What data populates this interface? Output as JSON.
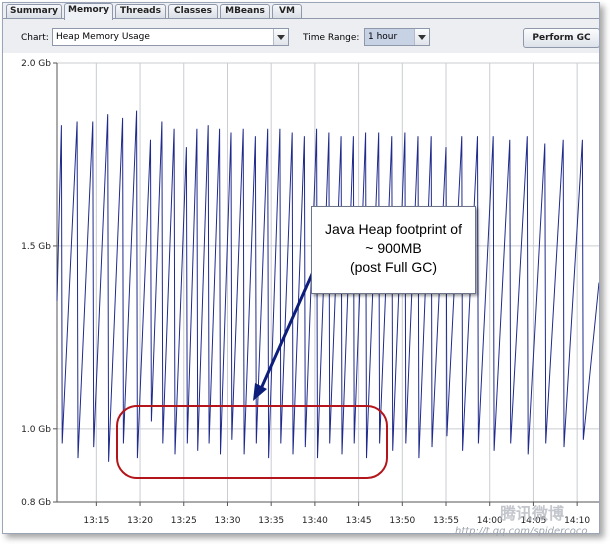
{
  "tabs": [
    {
      "label": "Summary",
      "active": false
    },
    {
      "label": "Memory",
      "active": true
    },
    {
      "label": "Threads",
      "active": false
    },
    {
      "label": "Classes",
      "active": false
    },
    {
      "label": "MBeans",
      "active": false
    },
    {
      "label": "VM",
      "active": false
    }
  ],
  "controls": {
    "chart_label": "Chart:",
    "chart_value": "Heap Memory Usage",
    "time_range_label": "Time Range:",
    "time_range_value": "1 hour",
    "perform_gc_label": "Perform GC"
  },
  "annotation": {
    "lines": [
      "Java Heap footprint of",
      "~ 900MB",
      "(post Full GC)"
    ],
    "arrow_color": "#0d1d7a",
    "ellipse_color": "#b3151a"
  },
  "watermark": {
    "logo_text": "腾讯微博",
    "url_text": "http://t.qq.com/spidercoco"
  },
  "chart_data": {
    "type": "line",
    "y_ticks": [
      "2.0 Gb",
      "1.5 Gb",
      "1.0 Gb",
      "0.8 Gb"
    ],
    "y_tick_values": [
      2.0,
      1.5,
      1.0,
      0.8
    ],
    "ylim": [
      0.8,
      2.0
    ],
    "x_ticks": [
      "13:15",
      "13:20",
      "13:25",
      "13:30",
      "13:35",
      "13:40",
      "13:45",
      "13:50",
      "13:55",
      "14:00",
      "14:05",
      "14:10"
    ],
    "x_tick_minutes": [
      15,
      20,
      25,
      30,
      35,
      40,
      45,
      50,
      55,
      60,
      65,
      70
    ],
    "xlim_minutes": [
      10.5,
      72.5
    ],
    "series_color": "#1f2a8c",
    "grid": true,
    "series": [
      {
        "points": [
          [
            10.5,
            1.35
          ],
          [
            11.0,
            1.83
          ],
          [
            11.1,
            0.96
          ],
          [
            12.8,
            1.84
          ],
          [
            12.9,
            0.92
          ],
          [
            14.6,
            1.84
          ],
          [
            14.7,
            0.95
          ],
          [
            16.3,
            1.86
          ],
          [
            16.4,
            0.91
          ],
          [
            18.0,
            1.85
          ],
          [
            18.1,
            0.96
          ],
          [
            19.6,
            1.87
          ],
          [
            19.7,
            0.92
          ],
          [
            21.2,
            1.79
          ],
          [
            21.3,
            1.02
          ],
          [
            22.5,
            1.84
          ],
          [
            22.6,
            0.96
          ],
          [
            23.9,
            1.82
          ],
          [
            24.0,
            0.93
          ],
          [
            25.3,
            1.77
          ],
          [
            25.4,
            0.96
          ],
          [
            26.5,
            1.82
          ],
          [
            26.6,
            0.94
          ],
          [
            27.8,
            1.83
          ],
          [
            27.9,
            0.96
          ],
          [
            29.1,
            1.82
          ],
          [
            29.2,
            0.93
          ],
          [
            30.4,
            1.81
          ],
          [
            30.5,
            0.97
          ],
          [
            31.8,
            1.82
          ],
          [
            31.9,
            0.93
          ],
          [
            33.2,
            1.8
          ],
          [
            33.3,
            0.96
          ],
          [
            34.6,
            1.82
          ],
          [
            34.7,
            0.92
          ],
          [
            36.0,
            1.82
          ],
          [
            36.1,
            0.96
          ],
          [
            37.4,
            1.81
          ],
          [
            37.5,
            0.93
          ],
          [
            38.8,
            1.8
          ],
          [
            38.9,
            0.95
          ],
          [
            40.2,
            1.82
          ],
          [
            40.3,
            0.92
          ],
          [
            41.6,
            1.81
          ],
          [
            41.7,
            0.96
          ],
          [
            43.0,
            1.8
          ],
          [
            43.1,
            0.93
          ],
          [
            44.4,
            1.8
          ],
          [
            44.5,
            0.96
          ],
          [
            45.8,
            1.81
          ],
          [
            45.9,
            0.92
          ],
          [
            47.3,
            1.81
          ],
          [
            47.4,
            0.96
          ],
          [
            48.8,
            1.8
          ],
          [
            48.9,
            0.94
          ],
          [
            50.3,
            1.81
          ],
          [
            50.4,
            0.96
          ],
          [
            51.8,
            1.8
          ],
          [
            51.9,
            0.92
          ],
          [
            53.3,
            1.8
          ],
          [
            53.4,
            0.95
          ],
          [
            55.0,
            1.77
          ],
          [
            55.1,
            0.98
          ],
          [
            56.8,
            1.8
          ],
          [
            56.9,
            0.94
          ],
          [
            58.6,
            1.8
          ],
          [
            58.7,
            0.96
          ],
          [
            60.4,
            1.8
          ],
          [
            60.5,
            0.94
          ],
          [
            62.3,
            1.79
          ],
          [
            62.4,
            0.96
          ],
          [
            64.3,
            1.8
          ],
          [
            64.4,
            0.93
          ],
          [
            66.3,
            1.78
          ],
          [
            66.4,
            0.96
          ],
          [
            68.4,
            1.79
          ],
          [
            68.5,
            0.95
          ],
          [
            70.6,
            1.79
          ],
          [
            70.7,
            0.97
          ],
          [
            72.5,
            1.4
          ]
        ]
      }
    ]
  }
}
